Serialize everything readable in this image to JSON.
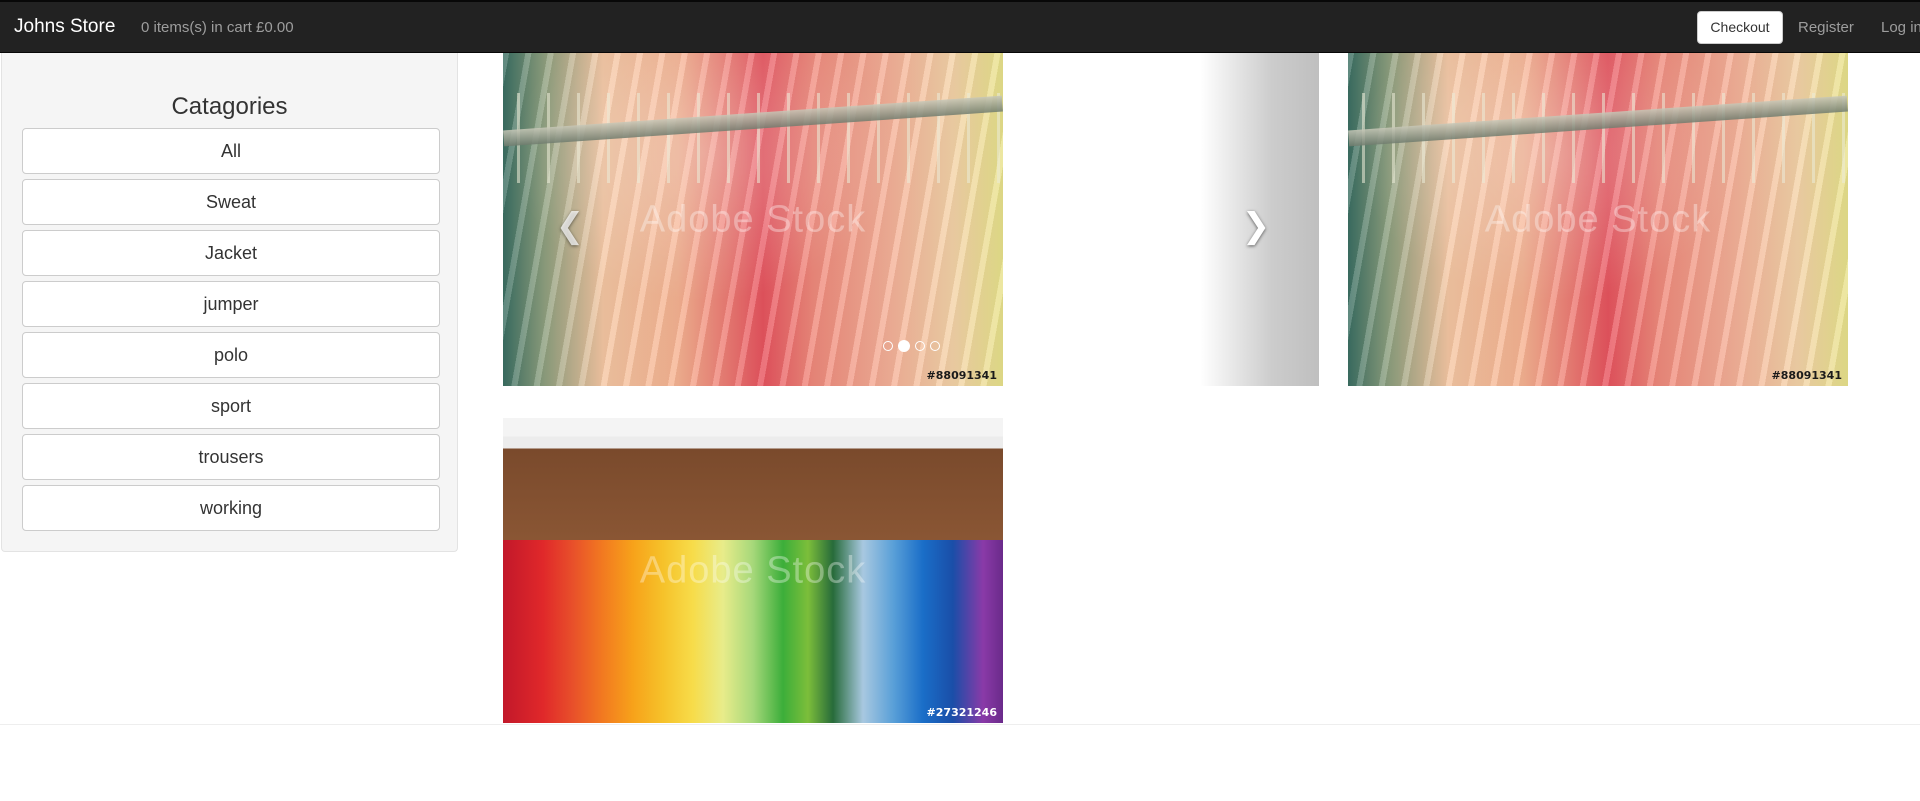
{
  "navbar": {
    "brand": "Johns Store",
    "cart_summary": "0 items(s) in cart £0.00",
    "checkout_label": "Checkout",
    "register_label": "Register",
    "login_label": "Log in"
  },
  "sidebar": {
    "title": "Catagories",
    "categories": [
      "All",
      "Sweat",
      "Jacket",
      "jumper",
      "polo",
      "sport",
      "trousers",
      "working"
    ]
  },
  "carousel": {
    "slides": [
      {
        "watermark": "Adobe Stock",
        "image_id": "#88091341"
      },
      {
        "watermark": "Adobe Stock",
        "image_id": "#88091341"
      }
    ],
    "indicator_count": 4,
    "active_indicator": 2
  },
  "products": [
    {
      "watermark": "Adobe Stock",
      "image_id": "#27321246"
    }
  ],
  "icons": {
    "prev": "chevron-left-icon",
    "next": "chevron-right-icon"
  }
}
